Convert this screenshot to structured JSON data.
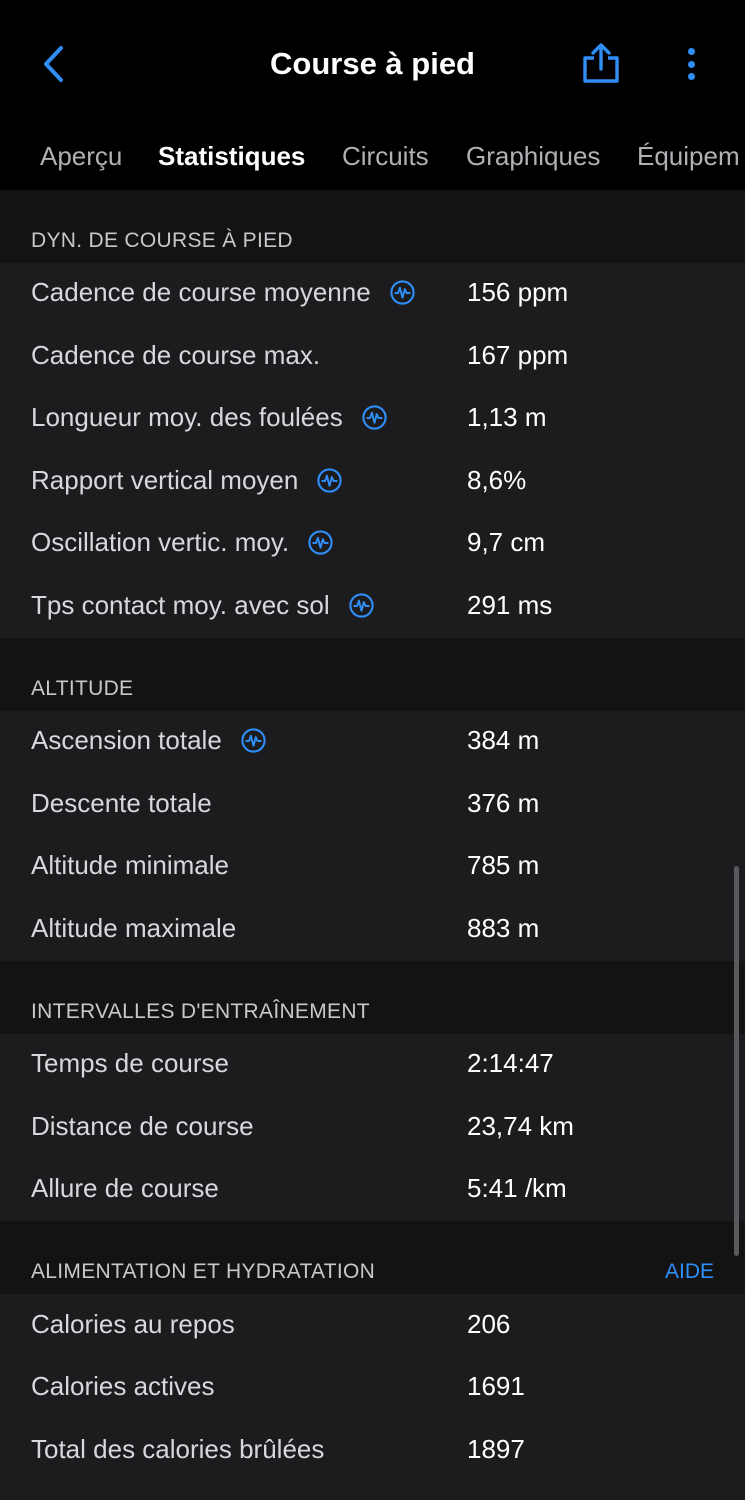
{
  "header": {
    "title": "Course à pied"
  },
  "tabs": [
    {
      "label": "Aperçu"
    },
    {
      "label": "Statistiques"
    },
    {
      "label": "Circuits"
    },
    {
      "label": "Graphiques"
    },
    {
      "label": "Équipem"
    }
  ],
  "icons": {
    "back": "chevron-left-icon",
    "share": "share-icon",
    "more": "more-vertical-icon",
    "info": "running-dynamics-icon"
  },
  "colors": {
    "accent": "#2f8ef7",
    "background": "#000000",
    "row_background": "#1c1c1e",
    "section_background": "#131314"
  },
  "sections": {
    "running_dynamics": {
      "label": "DYN. DE COURSE À PIED",
      "rows": [
        {
          "label": "Cadence de course moyenne",
          "value": "156 ppm"
        },
        {
          "label": "Cadence de course max.",
          "value": "167 ppm"
        },
        {
          "label": "Longueur moy. des foulées",
          "value": "1,13 m"
        },
        {
          "label": "Rapport vertical moyen",
          "value": "8,6%"
        },
        {
          "label": "Oscillation vertic. moy.",
          "value": "9,7 cm"
        },
        {
          "label": "Tps contact moy. avec sol",
          "value": "291 ms"
        }
      ]
    },
    "altitude": {
      "label": "ALTITUDE",
      "rows": [
        {
          "label": "Ascension totale",
          "value": "384 m"
        },
        {
          "label": "Descente totale",
          "value": "376 m"
        },
        {
          "label": "Altitude minimale",
          "value": "785 m"
        },
        {
          "label": "Altitude maximale",
          "value": "883 m"
        }
      ]
    },
    "intervals": {
      "label": "INTERVALLES D'ENTRAÎNEMENT",
      "rows": [
        {
          "label": "Temps de course",
          "value": "2:14:47"
        },
        {
          "label": "Distance de course",
          "value": "23,74 km"
        },
        {
          "label": "Allure de course",
          "value": "5:41 /km"
        }
      ]
    },
    "nutrition": {
      "label": "ALIMENTATION ET HYDRATATION",
      "help_label": "AIDE",
      "rows": [
        {
          "label": "Calories au repos",
          "value": "206"
        },
        {
          "label": "Calories actives",
          "value": "1691"
        },
        {
          "label": "Total des calories brûlées",
          "value": "1897"
        }
      ]
    }
  }
}
